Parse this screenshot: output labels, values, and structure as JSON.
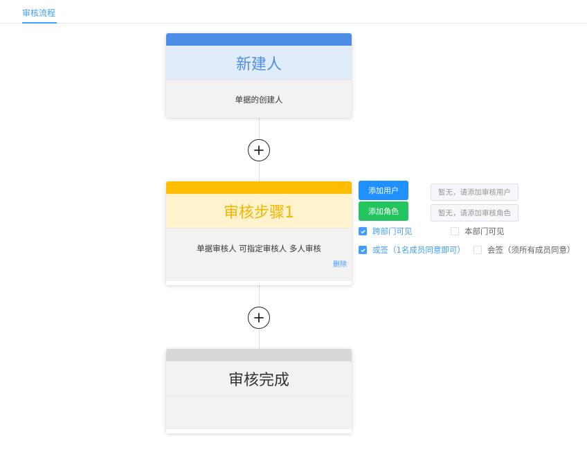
{
  "tabs": [
    {
      "label": "审核流程",
      "active": true
    }
  ],
  "colors": {
    "accent": "#409eff",
    "creator": "#4c8ee6",
    "step": "#fcbd00",
    "done": "#d8d8d8",
    "add_role": "#22c55e"
  },
  "flow": {
    "creator": {
      "title": "新建人",
      "description": "单据的创建人"
    },
    "step": {
      "title": "审核步骤1",
      "description": "单据审核人 可指定审核人 多人审核",
      "delete_label": "删除"
    },
    "done": {
      "title": "审核完成",
      "description": ""
    }
  },
  "step_config": {
    "add_user_label": "添加用户",
    "add_role_label": "添加角色",
    "users_empty": "暂无，请添加审核用户",
    "roles_empty": "暂无，请添加审核角色",
    "cross_dept": {
      "label": "跨部门可见",
      "checked": true
    },
    "own_dept": {
      "label": "本部门可见",
      "checked": false
    },
    "or_sign": {
      "label": "或签（1名成员同意即可）",
      "checked": true
    },
    "co_sign": {
      "label": "会签（须所有成员同意）",
      "checked": false
    }
  }
}
